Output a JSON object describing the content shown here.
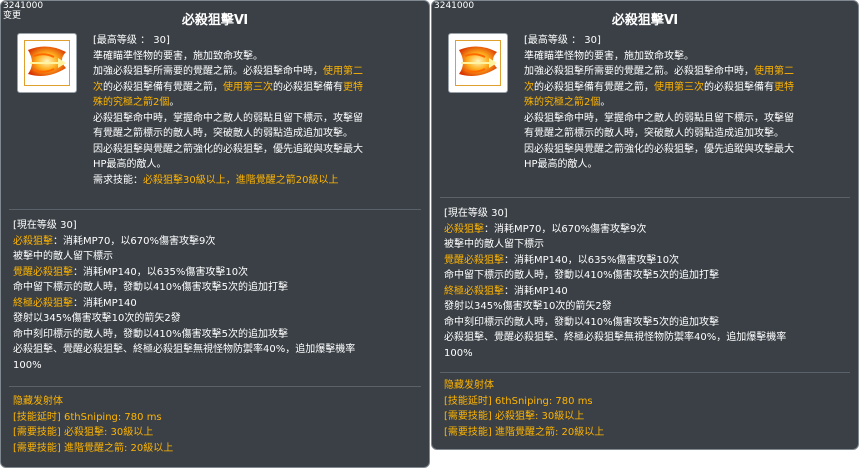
{
  "panels": [
    {
      "id": "3241000",
      "changed_label": "变更",
      "title": "必殺狙擊Ⅵ",
      "desc": {
        "max_level": "[最高等级 ： 30]",
        "line1": "準確瞄準怪物的要害，施加致命攻擊。",
        "line2a": "加強必殺狙擊所需要的覺醒之箭。必殺狙擊命中時，",
        "line2b": "使用第二",
        "line3a": "次",
        "line3b": "的必殺狙擊備有覺醒之箭，",
        "line3c": "使用第三次",
        "line3d": "的必殺狙擊備有",
        "line3e": "更特",
        "line4a": "殊的究極之箭2個",
        "line4b": "。",
        "line5": "必殺狙擊命中時，掌握命中之敵人的弱點且留下標示，攻擊留",
        "line6": "有覺醒之箭標示的敵人時，突破敵人的弱點造成追加攻擊。",
        "line7": "因必殺狙擊與覺醒之箭強化的必殺狙擊，優先追蹤與攻擊最大",
        "line8": "HP最高的敵人。",
        "req_label": "需求技能：",
        "req_value": "必殺狙擊30級以上，進階覺醒之箭20級以上"
      },
      "current_level": "[現在等级 30]",
      "skills": {
        "s1_name": "必殺狙擊",
        "s1_rest": "：消耗MP70，以670%傷害攻擊9次",
        "s1_line2": "被擊中的敵人留下標示",
        "s2_name": "覺醒必殺狙擊",
        "s2_rest": "：消耗MP140，以635%傷害攻擊10次",
        "s2_line2": "命中留下標示的敵人時，發動以410%傷害攻擊5次的追加打擊",
        "s3_name": "終極必殺狙擊",
        "s3_rest": "：消耗MP140",
        "s3_line2": "發射以345%傷害攻擊10次的箭矢2發",
        "s3_line3": "命中刻印標示的敵人時，發動以410%傷害攻擊5次的追加攻擊",
        "s3_line4": "必殺狙擊、覺醒必殺狙擊、終極必殺狙擊無視怪物防禦率40%，追加爆擊機率",
        "s3_line5": "100%"
      },
      "hidden": {
        "title": "隐藏发射体",
        "delay": "[技能延时] 6thSniping: 780 ms",
        "req1": "[需要技能] 必殺狙擊: 30級以上",
        "req2": "[需要技能] 進階覺醒之箭: 20級以上"
      }
    },
    {
      "id": "3241000",
      "changed_label": "",
      "title": "必殺狙擊Ⅵ",
      "desc": {
        "max_level": "[最高等级 ： 30]",
        "line1": "準確瞄準怪物的要害，施加致命攻擊。",
        "line2a": "加強必殺狙擊所需要的覺醒之箭。必殺狙擊命中時，",
        "line2b": "使用第二",
        "line3a": "次",
        "line3b": "的必殺狙擊備有覺醒之箭，",
        "line3c": "使用第三次",
        "line3d": "的必殺狙擊備有",
        "line3e": "更特",
        "line4a": "殊的究極之箭2個",
        "line4b": "。",
        "line5": "必殺狙擊命中時，掌握命中之敵人的弱點且留下標示，攻擊留",
        "line6": "有覺醒之箭標示的敵人時，突破敵人的弱點造成追加攻擊。",
        "line7": "因必殺狙擊與覺醒之箭強化的必殺狙擊，優先追蹤與攻擊最大",
        "line8": "HP最高的敵人。",
        "req_label": "",
        "req_value": ""
      },
      "current_level": "[現在等级 30]",
      "skills": {
        "s1_name": "必殺狙擊",
        "s1_rest": "：消耗MP70，以670%傷害攻擊9次",
        "s1_line2": "被擊中的敵人留下標示",
        "s2_name": "覺醒必殺狙擊",
        "s2_rest": "：消耗MP140，以635%傷害攻擊10次",
        "s2_line2": "命中留下標示的敵人時，發動以410%傷害攻擊5次的追加打擊",
        "s3_name": "終極必殺狙擊",
        "s3_rest": "：消耗MP140",
        "s3_line2": "發射以345%傷害攻擊10次的箭矢2發",
        "s3_line3": "命中刻印標示的敵人時，發動以410%傷害攻擊5次的追加攻擊",
        "s3_line4": "必殺狙擊、覺醒必殺狙擊、終極必殺狙擊無視怪物防禦率40%，追加爆擊機率",
        "s3_line5": "100%"
      },
      "hidden": {
        "title": "隐藏发射体",
        "delay": "[技能延时] 6thSniping: 780 ms",
        "req1": "[需要技能] 必殺狙擊: 30級以上",
        "req2": "[需要技能] 進階覺醒之箭: 20級以上"
      }
    }
  ],
  "colors": {
    "panel_bg": "#3a4046",
    "highlight": "#ffb400",
    "text": "#ffffff"
  },
  "icons": [
    "skill-icon-flaming-arrow"
  ]
}
